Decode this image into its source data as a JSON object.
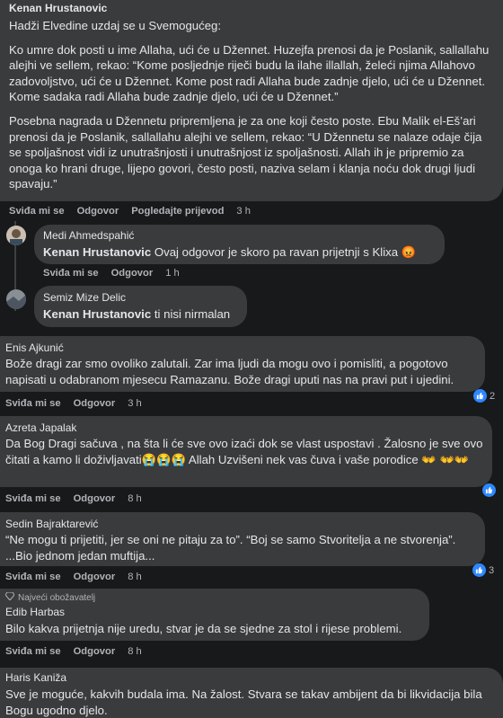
{
  "colors": {
    "bg": "#18191a",
    "bubble": "#3a3b3c",
    "meta": "#b0b3b8",
    "like": "#2d88ff"
  },
  "actions": {
    "like": "Sviđa mi se",
    "reply": "Odgovor",
    "translate": "Pogledajte prijevod"
  },
  "c1": {
    "author": "Kenan Hrustanovic",
    "p0": "Hadži Elvedine uzdaj se u Svemogućeg:",
    "p1": "Ko umre dok posti u ime Allaha, ući će u Džennet. Huzejfa prenosi da je Poslanik, sallallahu alejhi ve sellem, rekao: “Kome posljednje riječi budu la ilahe illallah, želeći njima Allahovo zadovoljstvo, ući će u Džennet. Kome post radi Allaha bude zadnje djelo, ući će u Džennet. Kome sadaka radi Allaha bude zadnje djelo, ući će u Džennet.”",
    "p2": "Posebna nagrada u Džennetu pripremljena je za one koji često poste. Ebu Malik el-Eš’ari prenosi da je Poslanik, sallallahu alejhi ve sellem, rekao: “U Džennetu se nalaze odaje čija se spoljašnost vidi iz unutrašnjosti i unutrašnjost iz spoljašnosti. Allah ih je pripremio za onoga ko hrani druge, lijepo govori, često posti, naziva selam i klanja noću dok drugi ljudi spavaju.”",
    "time": "3 h"
  },
  "r1": {
    "author": "Medi Ahmedspahić",
    "mention": "Kenan Hrustanovic",
    "text": " Ovaj odgovor je skoro pa ravan prijetnji s Klixa ",
    "emoji": "😡",
    "time": "1 h"
  },
  "r2": {
    "author": "Semiz Mize Delic",
    "mention": "Kenan Hrustanovic",
    "text": " ti nisi nirmalan",
    "hidden_actions": "Sviđa mi se  Odgovor  54 min"
  },
  "c2": {
    "author": "Enis Ajkunić",
    "text": "Bože dragi zar smo ovoliko zalutali. Zar ima ljudi da mogu ovo i pomisliti, a pogotovo napisati u odabranom mjesecu Ramazanu. Bože dragi uputi nas na pravi put i ujedini.",
    "time": "3 h",
    "reactions": "2"
  },
  "c3": {
    "author": "Azreta Japalak",
    "text": "Da Bog Dragi sačuva , na šta li će sve ovo izaći dok se vlast uspostavi . Žalosno je sve ovo čitati a kamo li doživljavati",
    "emojis": "😭😭😭",
    "text2": " Allah Uzvišeni nek vas čuva i vaše porodice ",
    "emojis2": "👐 👐👐",
    "time": "8 h"
  },
  "c4": {
    "author": "Sedin Bajraktarević",
    "text": "“Ne mogu ti prijetiti, jer se oni ne pitaju za to”. “Boj se samo Stvoritelja a ne stvorenja”. ...Bio jednom jedan muftija...",
    "time": "8 h",
    "reactions": "3"
  },
  "c5": {
    "badge": "Najveći obožavatelj",
    "author": "Edib Harbas",
    "text": "Bilo kakva prijetnja nije uredu, stvar je da se sjedne za stol i rijese problemi.",
    "time": "8 h"
  },
  "c6": {
    "author": "Haris Kaniža",
    "text": "Sve je moguće, kakvih budala ima. Na žalost. Stvara se takav ambijent da bi likvidacija bila Bogu ugodno djelo."
  }
}
